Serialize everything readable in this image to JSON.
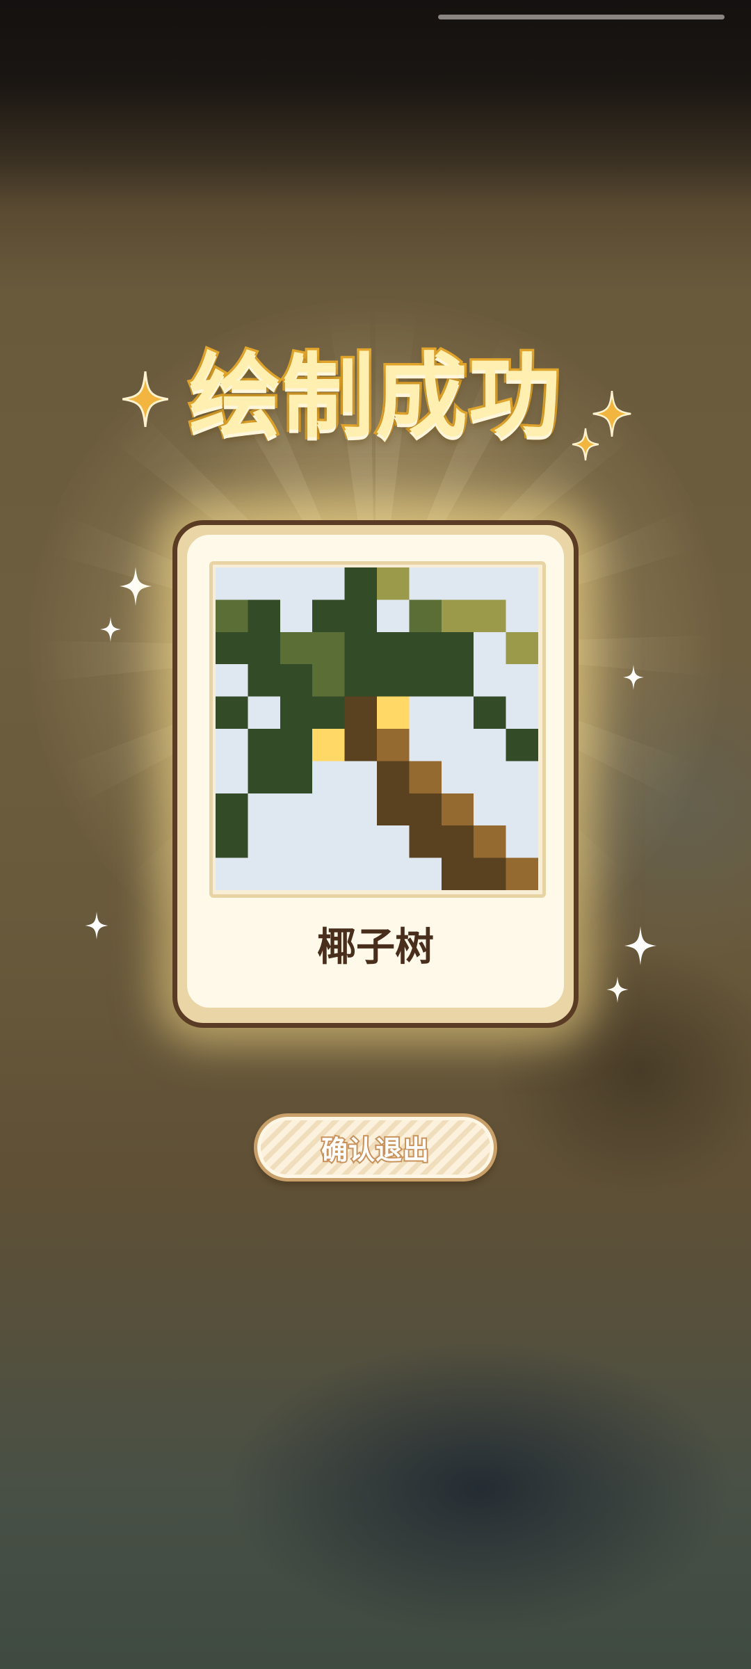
{
  "title": "绘制成功",
  "card": {
    "label": "椰子树",
    "grid": {
      "cols": 10,
      "rows": 10,
      "palette": {
        "0": "#dfe8f0",
        "1": "#344b28",
        "2": "#5b6e35",
        "3": "#9a9a4a",
        "4": "#5a4220",
        "5": "#956a30",
        "6": "#ffd866"
      },
      "cells": [
        [
          0,
          0,
          0,
          0,
          1,
          3,
          0,
          0,
          0,
          0
        ],
        [
          2,
          1,
          0,
          1,
          1,
          0,
          2,
          3,
          3,
          0
        ],
        [
          1,
          1,
          2,
          2,
          1,
          1,
          1,
          1,
          0,
          3
        ],
        [
          0,
          1,
          1,
          2,
          1,
          1,
          1,
          1,
          0,
          0
        ],
        [
          1,
          0,
          1,
          1,
          4,
          6,
          0,
          0,
          1,
          0
        ],
        [
          0,
          1,
          1,
          6,
          4,
          5,
          0,
          0,
          0,
          1
        ],
        [
          0,
          1,
          1,
          0,
          0,
          4,
          5,
          0,
          0,
          0
        ],
        [
          1,
          0,
          0,
          0,
          0,
          4,
          4,
          5,
          0,
          0
        ],
        [
          1,
          0,
          0,
          0,
          0,
          0,
          4,
          4,
          5,
          0
        ],
        [
          0,
          0,
          0,
          0,
          0,
          0,
          0,
          4,
          4,
          5
        ]
      ]
    }
  },
  "buttons": {
    "confirm_exit": "确认退出"
  },
  "colors": {
    "title_fill": "#ffefb0",
    "title_stroke": "#e2a52c",
    "card_border": "#5a3b24",
    "sparkle_gold": "#f2b640",
    "sparkle_white": "#ffffff"
  }
}
